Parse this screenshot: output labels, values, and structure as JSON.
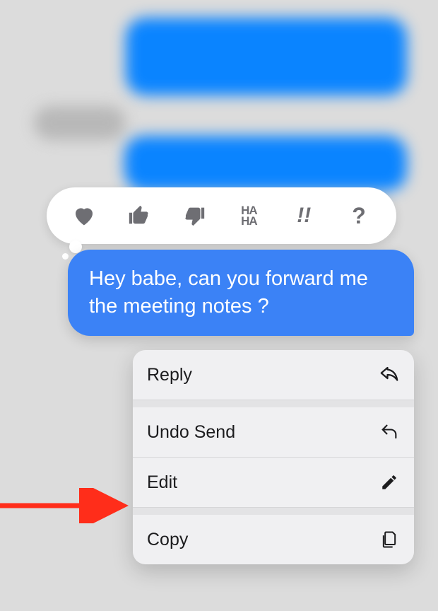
{
  "message": {
    "text": "Hey babe, can you forward me the meeting notes ?"
  },
  "reactions": {
    "heart": "heart",
    "thumbs_up": "thumbs-up",
    "thumbs_down": "thumbs-down",
    "haha": "HA HA",
    "exclaim": "!!",
    "question": "?"
  },
  "menu": {
    "reply": "Reply",
    "undo_send": "Undo Send",
    "edit": "Edit",
    "copy": "Copy"
  }
}
